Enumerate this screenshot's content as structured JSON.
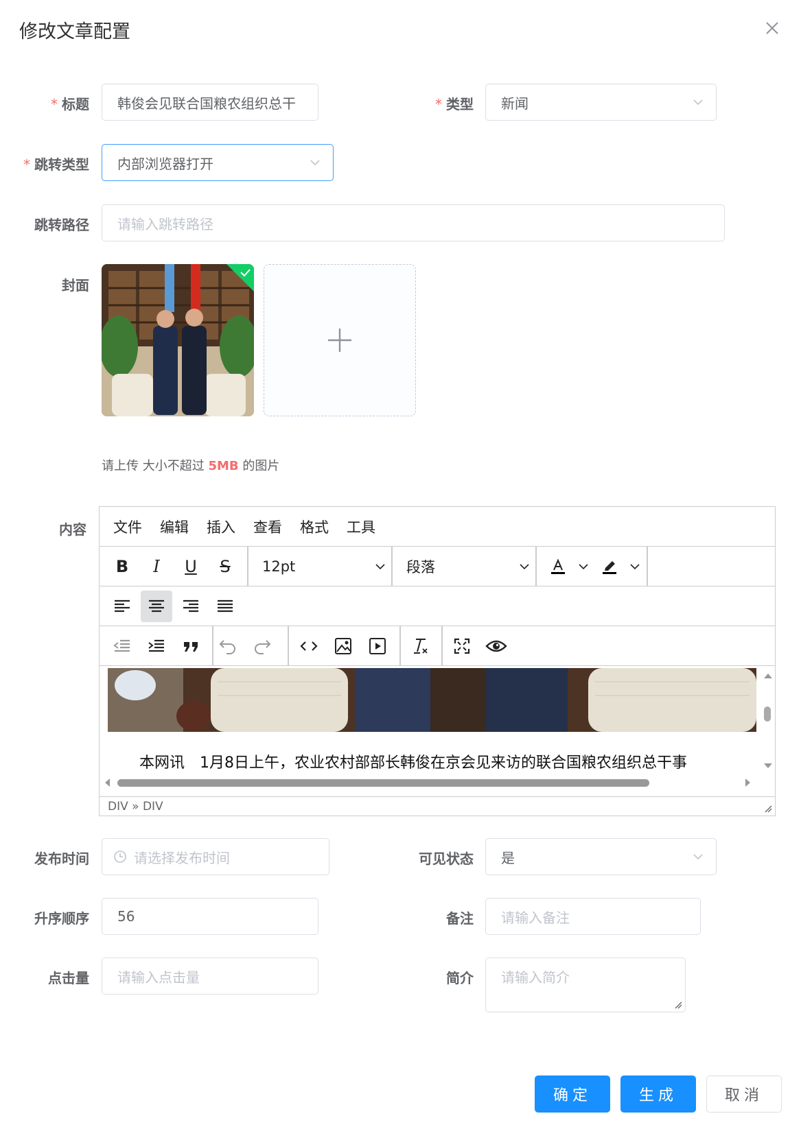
{
  "dialog": {
    "title": "修改文章配置"
  },
  "form": {
    "title": {
      "label": "标题",
      "value": "韩俊会见联合国粮农组织总干"
    },
    "type": {
      "label": "类型",
      "value": "新闻"
    },
    "jump_type": {
      "label": "跳转类型",
      "value": "内部浏览器打开"
    },
    "jump_path": {
      "label": "跳转路径",
      "placeholder": "请输入跳转路径"
    },
    "cover": {
      "label": "封面",
      "hint_prefix": "请上传 大小不超过 ",
      "hint_size": "5MB",
      "hint_suffix": " 的图片"
    },
    "content": {
      "label": "内容"
    },
    "publish_time": {
      "label": "发布时间",
      "placeholder": "请选择发布时间"
    },
    "visible": {
      "label": "可见状态",
      "value": "是"
    },
    "sort": {
      "label": "升序顺序",
      "value": "56"
    },
    "remark": {
      "label": "备注",
      "placeholder": "请输入备注"
    },
    "clicks": {
      "label": "点击量",
      "placeholder": "请输入点击量"
    },
    "intro": {
      "label": "简介",
      "placeholder": "请输入简介"
    }
  },
  "editor": {
    "menu": [
      "文件",
      "编辑",
      "插入",
      "查看",
      "格式",
      "工具"
    ],
    "font_size": "12pt",
    "block_format": "段落",
    "body_text": "本网讯　1月8日上午，农业农村部部长韩俊在京会见来访的联合国粮农组织总干事",
    "path": "DIV » DIV"
  },
  "buttons": {
    "confirm": "确定",
    "generate": "生成",
    "cancel": "取消"
  },
  "colors": {
    "primary": "#1890ff",
    "required": "#f56c6c",
    "border": "#dcdfe6"
  }
}
